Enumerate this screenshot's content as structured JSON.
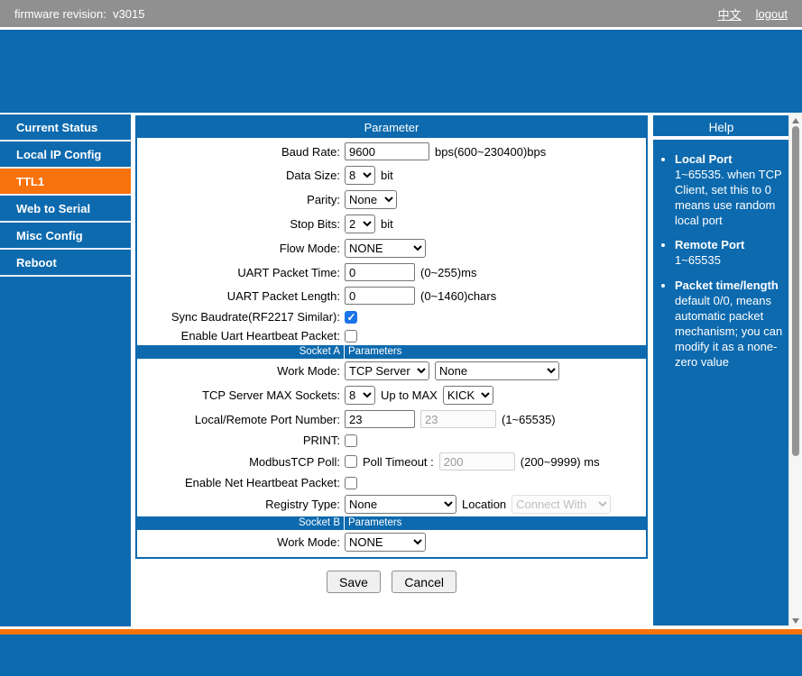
{
  "topbar": {
    "firmware_label": "firmware revision:  v3015",
    "lang_link": "中文",
    "logout_link": "logout"
  },
  "sidebar": {
    "items": [
      {
        "label": "Current Status",
        "active": false
      },
      {
        "label": "Local IP Config",
        "active": false
      },
      {
        "label": "TTL1",
        "active": true
      },
      {
        "label": "Web to Serial",
        "active": false
      },
      {
        "label": "Misc Config",
        "active": false
      },
      {
        "label": "Reboot",
        "active": false
      }
    ]
  },
  "panel": {
    "title": "Parameter",
    "uart": {
      "baud_rate": {
        "label": "Baud Rate:",
        "value": "9600",
        "suffix": "bps(600~230400)bps"
      },
      "data_size": {
        "label": "Data Size:",
        "value": "8",
        "suffix": "bit"
      },
      "parity": {
        "label": "Parity:",
        "value": "None"
      },
      "stop_bits": {
        "label": "Stop Bits:",
        "value": "2",
        "suffix": "bit"
      },
      "flow_mode": {
        "label": "Flow Mode:",
        "value": "NONE"
      },
      "packet_time": {
        "label": "UART Packet Time:",
        "value": "0",
        "suffix": "(0~255)ms"
      },
      "packet_length": {
        "label": "UART Packet Length:",
        "value": "0",
        "suffix": "(0~1460)chars"
      },
      "sync_baudrate": {
        "label": "Sync Baudrate(RF2217 Similar):",
        "checked": true
      },
      "uart_heartbeat": {
        "label": "Enable Uart Heartbeat Packet:",
        "checked": false
      }
    },
    "socket_a": {
      "header_left": "Socket A",
      "header_right": "Parameters",
      "work_mode": {
        "label": "Work Mode:",
        "mode": "TCP Server",
        "submode": "None"
      },
      "max_sockets": {
        "label": "TCP Server MAX Sockets:",
        "value": "8",
        "mid_label": "Up to MAX",
        "policy": "KICK"
      },
      "port": {
        "label": "Local/Remote Port Number:",
        "local_value": "23",
        "remote_value": "23",
        "suffix": "(1~65535)"
      },
      "print": {
        "label": "PRINT:",
        "checked": false
      },
      "modbus_poll": {
        "label": "ModbusTCP Poll:",
        "checked": false,
        "timeout_label": "Poll Timeout :",
        "timeout_value": "200",
        "suffix": "(200~9999) ms"
      },
      "net_heartbeat": {
        "label": "Enable Net Heartbeat Packet:",
        "checked": false
      },
      "registry": {
        "label": "Registry Type:",
        "value": "None",
        "location_label": "Location",
        "location_value": "Connect With"
      }
    },
    "socket_b": {
      "header_left": "Socket B",
      "header_right": "Parameters",
      "work_mode": {
        "label": "Work Mode:",
        "value": "NONE"
      }
    }
  },
  "actions": {
    "save": "Save",
    "cancel": "Cancel"
  },
  "help": {
    "title": "Help",
    "items": [
      {
        "title": "Local Port",
        "body": "1~65535. when TCP Client, set this to 0 means use random local port"
      },
      {
        "title": "Remote Port",
        "body": "1~65535"
      },
      {
        "title": "Packet time/length",
        "body": "default 0/0, means automatic packet mechanism; you can modify it as a none-zero value"
      }
    ]
  },
  "colors": {
    "brand_blue": "#0d6aae",
    "accent_orange": "#f8720d",
    "topbar_gray": "#909090",
    "checkbox_blue": "#1a73e8"
  }
}
